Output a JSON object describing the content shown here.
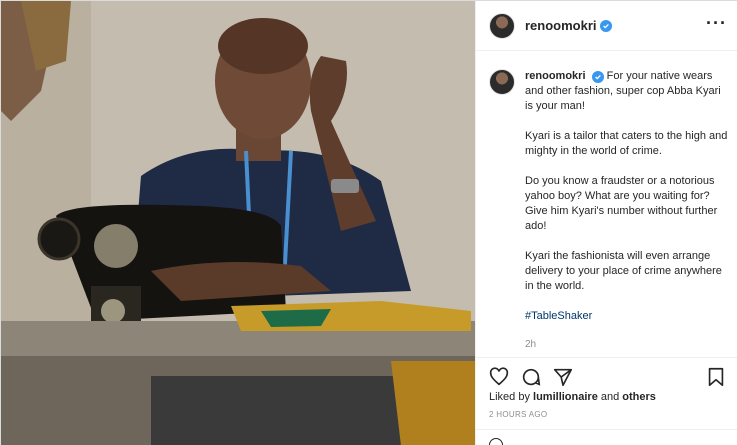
{
  "post": {
    "username": "renoomokri",
    "caption_paragraphs": [
      "For your native wears and other fashion, super cop Abba Kyari is your man!",
      "Kyari is a tailor that caters to the high and mighty in the world of crime.",
      "Do you know a fraudster or a notorious yahoo boy? What are you waiting for? Give him Kyari's number without further ado!",
      "Kyari the fashionista will even arrange delivery to your place of crime anywhere in the world."
    ],
    "hashtag": "#TableShaker",
    "caption_age": "2h",
    "liked_by_prefix": "Liked by ",
    "liked_by_user": "lumillionaire",
    "liked_by_suffix": " and ",
    "liked_by_others": "others",
    "timestamp": "2 HOURS AGO"
  },
  "icons": {
    "more": "more-options-icon",
    "verified": "verified-badge-icon",
    "like": "heart-icon",
    "comment": "comment-bubble-icon",
    "share": "paper-plane-icon",
    "save": "bookmark-icon",
    "emoji": "smiley-icon"
  },
  "colors": {
    "verified": "#3897f0",
    "hashtag": "#00376b",
    "muted": "#8e8e8e"
  }
}
